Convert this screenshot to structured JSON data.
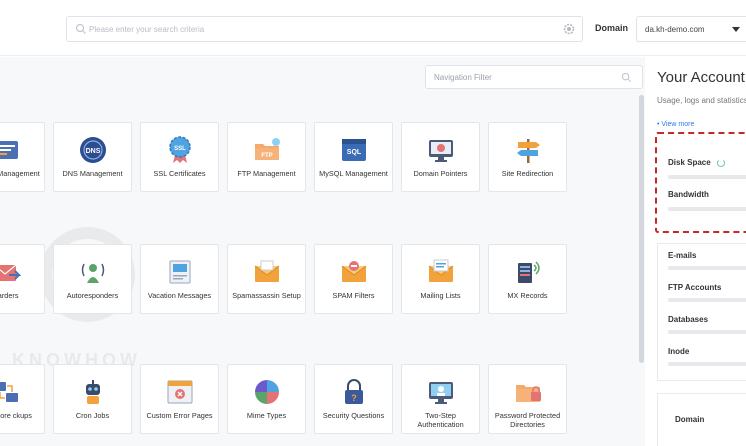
{
  "header": {
    "search_placeholder": "Please enter your search criteria",
    "domain_label": "Domain",
    "domain_value": "da.kh-demo.com"
  },
  "content": {
    "nav_filter_placeholder": "Navigation Filter",
    "rows": [
      [
        "domain Management",
        "DNS Management",
        "SSL Certificates",
        "FTP Management",
        "MySQL Management",
        "Domain Pointers",
        "Site Redirection"
      ],
      [
        "warders",
        "Autoresponders",
        "Vacation Messages",
        "Spamassassin Setup",
        "SPAM Filters",
        "Mailing Lists",
        "MX Records"
      ],
      [
        "e/Restore ckups",
        "Cron Jobs",
        "Custom Error Pages",
        "Mime Types",
        "Security Questions",
        "Two-Step Authentication",
        "Password Protected Directories"
      ]
    ],
    "icons": [
      [
        "subdomain-icon",
        "dns-icon",
        "ssl-certificate-icon",
        "ftp-folder-icon",
        "mysql-database-icon",
        "domain-pointer-icon",
        "signpost-icon"
      ],
      [
        "forwarder-icon",
        "autoresponder-icon",
        "vacation-message-icon",
        "spam-envelope-icon",
        "spam-filter-icon",
        "mailing-list-icon",
        "mx-records-icon"
      ],
      [
        "backup-restore-icon",
        "cron-robot-icon",
        "error-page-icon",
        "mime-types-icon",
        "security-lock-icon",
        "two-step-auth-icon",
        "password-folder-icon"
      ]
    ]
  },
  "account_panel": {
    "title": "Your Account",
    "subtitle": "Usage, logs and statistics",
    "view_more": "• View more",
    "stats": [
      "Disk Space",
      "Bandwidth",
      "E-mails",
      "FTP Accounts",
      "Databases",
      "Inode"
    ],
    "domain_label": "Domain"
  },
  "colors": {
    "highlight_border": "#c62828",
    "link": "#2c7be5",
    "tile_border": "#e3e6eb"
  }
}
